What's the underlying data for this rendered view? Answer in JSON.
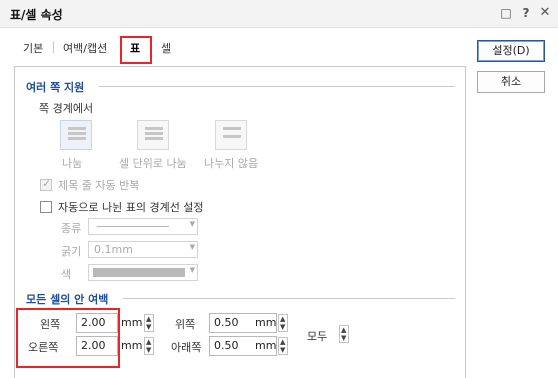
{
  "window": {
    "title": "표/셀 속성",
    "icons": [
      "comment-icon",
      "help-icon",
      "close-icon"
    ]
  },
  "tabs": [
    {
      "label": "기본"
    },
    {
      "label": "여백/캡션"
    },
    {
      "label": "표",
      "active": true
    },
    {
      "label": "셀"
    }
  ],
  "buttons": {
    "ok": "설정(D)",
    "cancel": "취소"
  },
  "multipage": {
    "title": "여러 쪽 지원",
    "boundary_label": "쪽 경계에서",
    "options": [
      {
        "label": "나눔",
        "icon": "split-table-icon",
        "selected": true
      },
      {
        "label": "셀 단위로 나눔",
        "icon": "split-by-cell-icon"
      },
      {
        "label": "나누지 않음",
        "icon": "no-split-icon"
      }
    ],
    "repeat_header": "제목 줄 자동 반복",
    "set_border": "자동으로 나뉜 표의 경계선 설정",
    "kind_label": "종류",
    "thickness_label": "굵기",
    "thickness_value": "0.1mm",
    "color_label": "색"
  },
  "margins": {
    "title": "모든 셀의 안 여백",
    "left_label": "왼쪽",
    "left_value": "2.00",
    "right_label": "오른쪽",
    "right_value": "2.00",
    "top_label": "위쪽",
    "top_value": "0.50",
    "bottom_label": "아래쪽",
    "bottom_value": "0.50",
    "unit": "mm",
    "all_label": "모두"
  },
  "accent_colors": {
    "highlight": "#e8262a",
    "group_title": "#1f4e9c"
  }
}
